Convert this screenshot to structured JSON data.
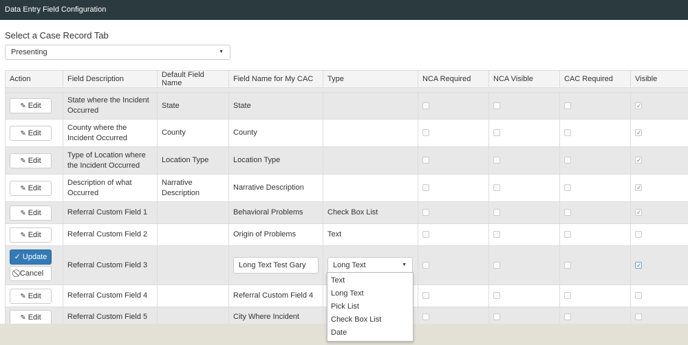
{
  "window": {
    "title": "Data Entry Field Configuration"
  },
  "tab_selector": {
    "label": "Select a Case Record Tab",
    "value": "Presenting"
  },
  "columns": [
    "Action",
    "Field Description",
    "Default Field Name",
    "Field Name for My CAC",
    "Type",
    "NCA Required",
    "NCA Visible",
    "CAC Required",
    "Visible"
  ],
  "buttons": {
    "edit": "Edit",
    "update": "Update",
    "cancel": "Cancel"
  },
  "rows": [
    {
      "description": "State where the Incident Occurred",
      "default_name": "State",
      "cac_name": "State",
      "type": "",
      "nca_required": false,
      "nca_visible": false,
      "cac_required": false,
      "visible": true
    },
    {
      "description": "County where the Incident Occurred",
      "default_name": "County",
      "cac_name": "County",
      "type": "",
      "nca_required": false,
      "nca_visible": false,
      "cac_required": false,
      "visible": true
    },
    {
      "description": "Type of Location where the Incident Occurred",
      "default_name": "Location Type",
      "cac_name": "Location Type",
      "type": "",
      "nca_required": false,
      "nca_visible": false,
      "cac_required": false,
      "visible": true
    },
    {
      "description": "Description of what Occurred",
      "default_name": "Narrative Description",
      "cac_name": "Narrative Description",
      "type": "",
      "nca_required": false,
      "nca_visible": false,
      "cac_required": false,
      "visible": true
    },
    {
      "description": "Referral Custom Field 1",
      "default_name": "",
      "cac_name": "Behavioral Problems",
      "type": "Check Box List",
      "nca_required": false,
      "nca_visible": false,
      "cac_required": false,
      "visible": true
    },
    {
      "description": "Referral Custom Field 2",
      "default_name": "",
      "cac_name": "Origin of Problems",
      "type": "Text",
      "nca_required": false,
      "nca_visible": false,
      "cac_required": false,
      "visible": false
    },
    {
      "description": "Referral Custom Field 3",
      "default_name": "",
      "cac_name": "Long Text Test Gary",
      "type": "Long Text",
      "nca_required": false,
      "nca_visible": false,
      "cac_required": false,
      "visible": true,
      "editing": true
    },
    {
      "description": "Referral Custom Field 4",
      "default_name": "",
      "cac_name": "Referral Custom Field 4",
      "type": "",
      "nca_required": false,
      "nca_visible": false,
      "cac_required": false,
      "visible": false
    },
    {
      "description": "Referral Custom Field 5",
      "default_name": "",
      "cac_name": "City Where Incident",
      "type": "",
      "nca_required": false,
      "nca_visible": false,
      "cac_required": false,
      "visible": false
    }
  ],
  "type_options": [
    "Text",
    "Long Text",
    "Pick List",
    "Check Box List",
    "Date"
  ]
}
